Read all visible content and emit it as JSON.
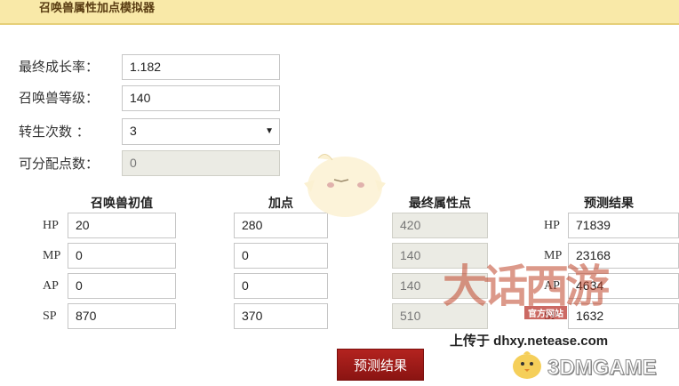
{
  "header": {
    "title": "召唤兽属性加点模拟器"
  },
  "form": {
    "growth_label": "最终成长率：",
    "growth_value": "1.182",
    "level_label": "召唤兽等级：",
    "level_value": "140",
    "rebirth_label": "转生次数   ：",
    "rebirth_value": "3",
    "points_label": "可分配点数：",
    "points_value": "0"
  },
  "table": {
    "headers": [
      "召唤兽初值",
      "加点",
      "最终属性点",
      "预测结果"
    ],
    "rows": [
      {
        "stat": "HP",
        "initial": "20",
        "added": "280",
        "final": "420",
        "result_label": "HP",
        "result": "71839"
      },
      {
        "stat": "MP",
        "initial": "0",
        "added": "0",
        "final": "140",
        "result_label": "MP",
        "result": "23168"
      },
      {
        "stat": "AP",
        "initial": "0",
        "added": "0",
        "final": "140",
        "result_label": "AP",
        "result": "4634"
      },
      {
        "stat": "SP",
        "initial": "870",
        "added": "370",
        "final": "510",
        "result_label": "SP",
        "result": "1632"
      }
    ]
  },
  "button": {
    "predict_label": "预测结果"
  },
  "watermark": {
    "logo_text": "大话西游",
    "sub_text": "官方网站",
    "upload_text": "上传于 dhxy.netease.com",
    "brand_text": "3DMGAME"
  },
  "colors": {
    "header_bg": "#f9e9a8",
    "button_bg": "#a11b18",
    "disabled_bg": "#ebebe4"
  }
}
